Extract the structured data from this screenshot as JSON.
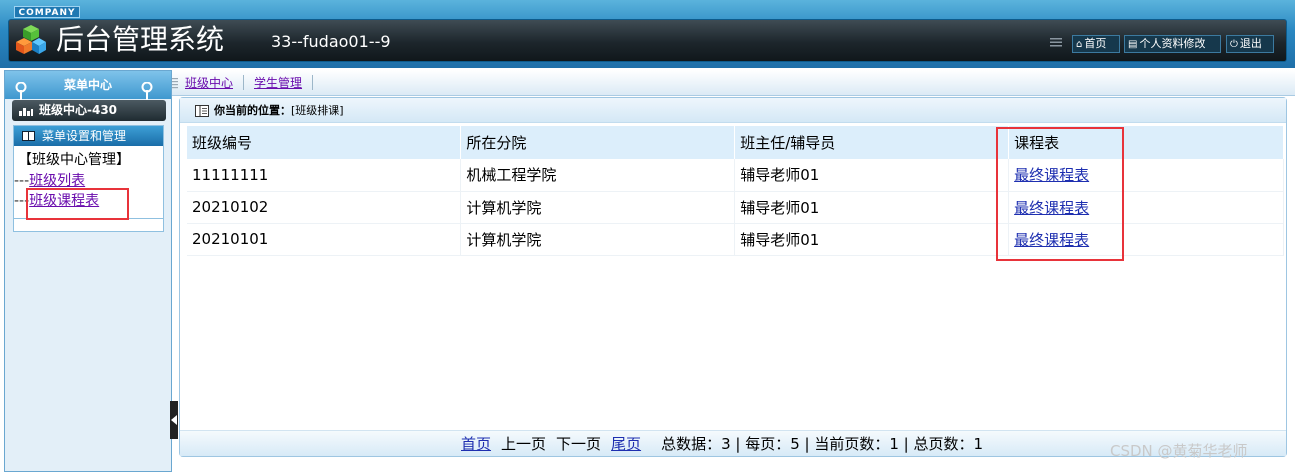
{
  "header": {
    "company_badge": "COMPANY",
    "app_title": "后台管理系统",
    "user_info": "33--fudao01--9",
    "buttons": {
      "home": "首页",
      "profile": "个人资料修改",
      "logout": "退出"
    }
  },
  "sidebar": {
    "menu_center": "菜单中心",
    "class_center": "班级中心-430",
    "menu_box_title": "菜单设置和管理",
    "group_title": "【班级中心管理】",
    "items": [
      {
        "prefix": "---",
        "label": "班级列表"
      },
      {
        "prefix": "---",
        "label": "班级课程表"
      }
    ]
  },
  "tabs": [
    "班级中心",
    "学生管理"
  ],
  "location": {
    "label": "你当前的位置：",
    "path": "[班级排课]"
  },
  "table": {
    "columns": [
      "班级编号",
      "所在分院",
      "班主任/辅导员",
      "课程表"
    ],
    "rows": [
      [
        "11111111",
        "机械工程学院",
        "辅导老师01",
        "最终课程表"
      ],
      [
        "20210102",
        "计算机学院",
        "辅导老师01",
        "最终课程表"
      ],
      [
        "20210101",
        "计算机学院",
        "辅导老师01",
        "最终课程表"
      ]
    ]
  },
  "pager": {
    "first": "首页",
    "prev": "上一页",
    "next": "下一页",
    "last": "尾页",
    "summary": "总数据：3 | 每页：5 | 当前页数：1 | 总页数：1"
  },
  "watermark": "CSDN @黄菊华老师",
  "colors": {
    "header_dark": "#1d262c",
    "header_blue": "#2a88c2",
    "link_purple": "#6a0dad",
    "link_blue": "#1e2fb0",
    "annotation_red": "#e8333a",
    "table_header_bg": "#dceefb"
  },
  "icons": [
    "logo-icon",
    "grip-icon",
    "home-icon",
    "profile-icon",
    "power-icon",
    "pin-icon",
    "grid-icon",
    "book-icon",
    "collapse-arrow-icon"
  ]
}
